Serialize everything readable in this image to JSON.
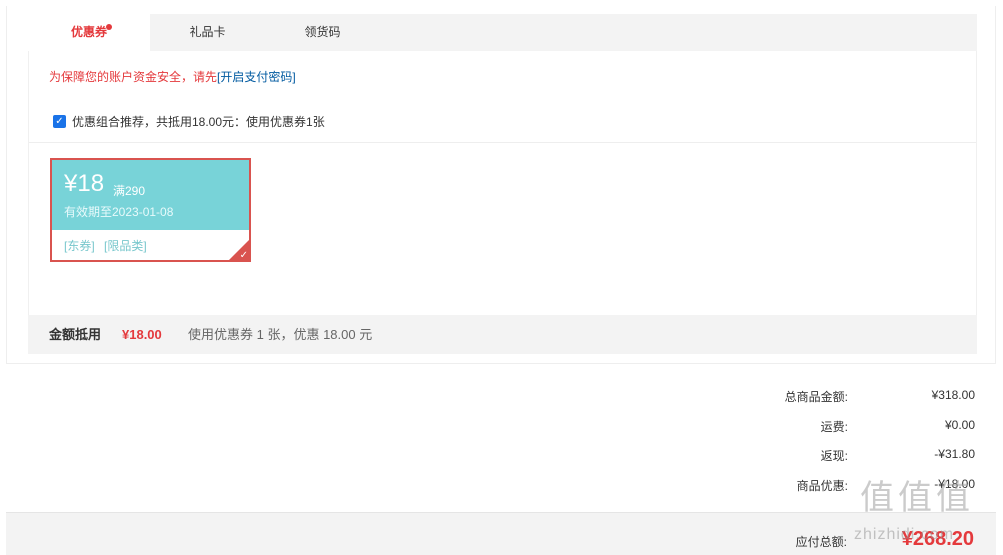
{
  "tabs": [
    {
      "label": "优惠券",
      "active": true,
      "has_dot": true
    },
    {
      "label": "礼品卡",
      "active": false
    },
    {
      "label": "领货码",
      "active": false
    }
  ],
  "warning": {
    "text": "为保障您的账户资金安全，请先",
    "link": "[开启支付密码]"
  },
  "combo": {
    "checked": true,
    "text": "优惠组合推荐，共抵用18.00元：使用优惠券1张"
  },
  "coupon": {
    "amount": "¥18",
    "condition": "满290",
    "validity": "有效期至2023-01-08",
    "tags": [
      "[东券]",
      "[限品类]"
    ],
    "selected": true
  },
  "summary": {
    "label": "金额抵用",
    "amount": "¥18.00",
    "desc": "使用优惠券 1 张，优惠 18.00 元"
  },
  "totals": [
    {
      "label": "总商品金额:",
      "value": "¥318.00"
    },
    {
      "label": "运费:",
      "value": "¥0.00"
    },
    {
      "label": "返现:",
      "value": "-¥31.80"
    },
    {
      "label": "商品优惠:",
      "value": "-¥18.00"
    }
  ],
  "payable": {
    "label": "应付总额:",
    "value": "¥268.20"
  },
  "watermark": {
    "icons": "值值值",
    "text": "zhizhidi.com"
  },
  "colors": {
    "accent": "#e4393c",
    "coupon_bg": "#78d3d8",
    "link": "#005aa0"
  }
}
